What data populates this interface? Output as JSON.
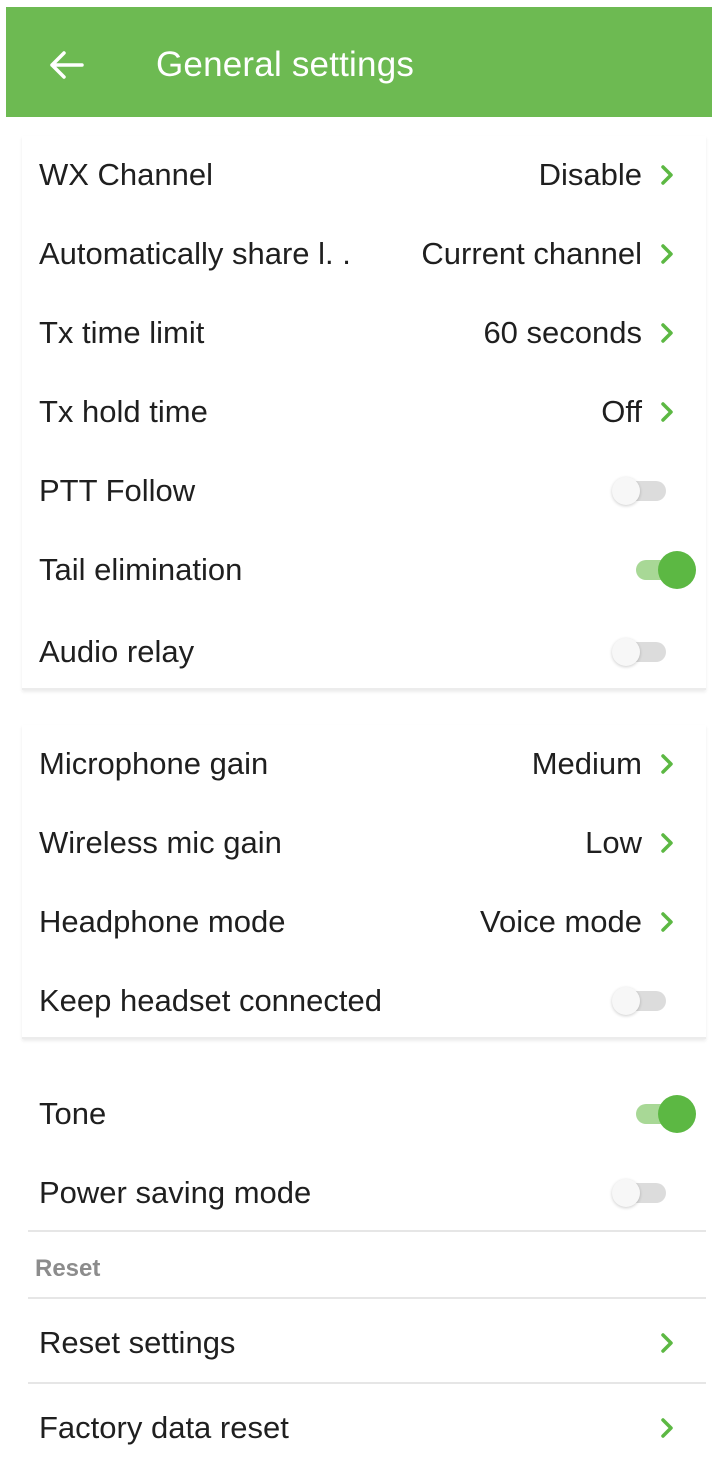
{
  "header": {
    "title": "General settings",
    "back_icon": "arrow-left-icon",
    "bg_color": "#6dba52"
  },
  "group1": {
    "items": [
      {
        "label": "WX Channel",
        "value": "Disable"
      },
      {
        "label": "Automatically share l. .",
        "value": "Current channel"
      },
      {
        "label": "Tx time limit",
        "value": "60 seconds"
      },
      {
        "label": "Tx hold time",
        "value": "Off"
      },
      {
        "label": "PTT Follow",
        "toggle": false
      },
      {
        "label": "Tail elimination",
        "toggle": true
      },
      {
        "label": "Audio relay",
        "toggle": false
      }
    ]
  },
  "group2": {
    "items": [
      {
        "label": "Microphone gain",
        "value": "Medium"
      },
      {
        "label": "Wireless mic gain",
        "value": "Low"
      },
      {
        "label": "Headphone mode",
        "value": "Voice mode"
      },
      {
        "label": "Keep headset connected",
        "toggle": false
      }
    ]
  },
  "group3": {
    "items": [
      {
        "label": "Tone",
        "toggle": true
      },
      {
        "label": "Power saving mode",
        "toggle": false
      }
    ]
  },
  "reset_section": {
    "header": "Reset",
    "items": [
      {
        "label": "Reset settings"
      },
      {
        "label": "Factory data reset"
      }
    ]
  },
  "colors": {
    "accent": "#5cb843",
    "chevron": "#5cb843",
    "toggle_off": "#dcdcdc"
  }
}
